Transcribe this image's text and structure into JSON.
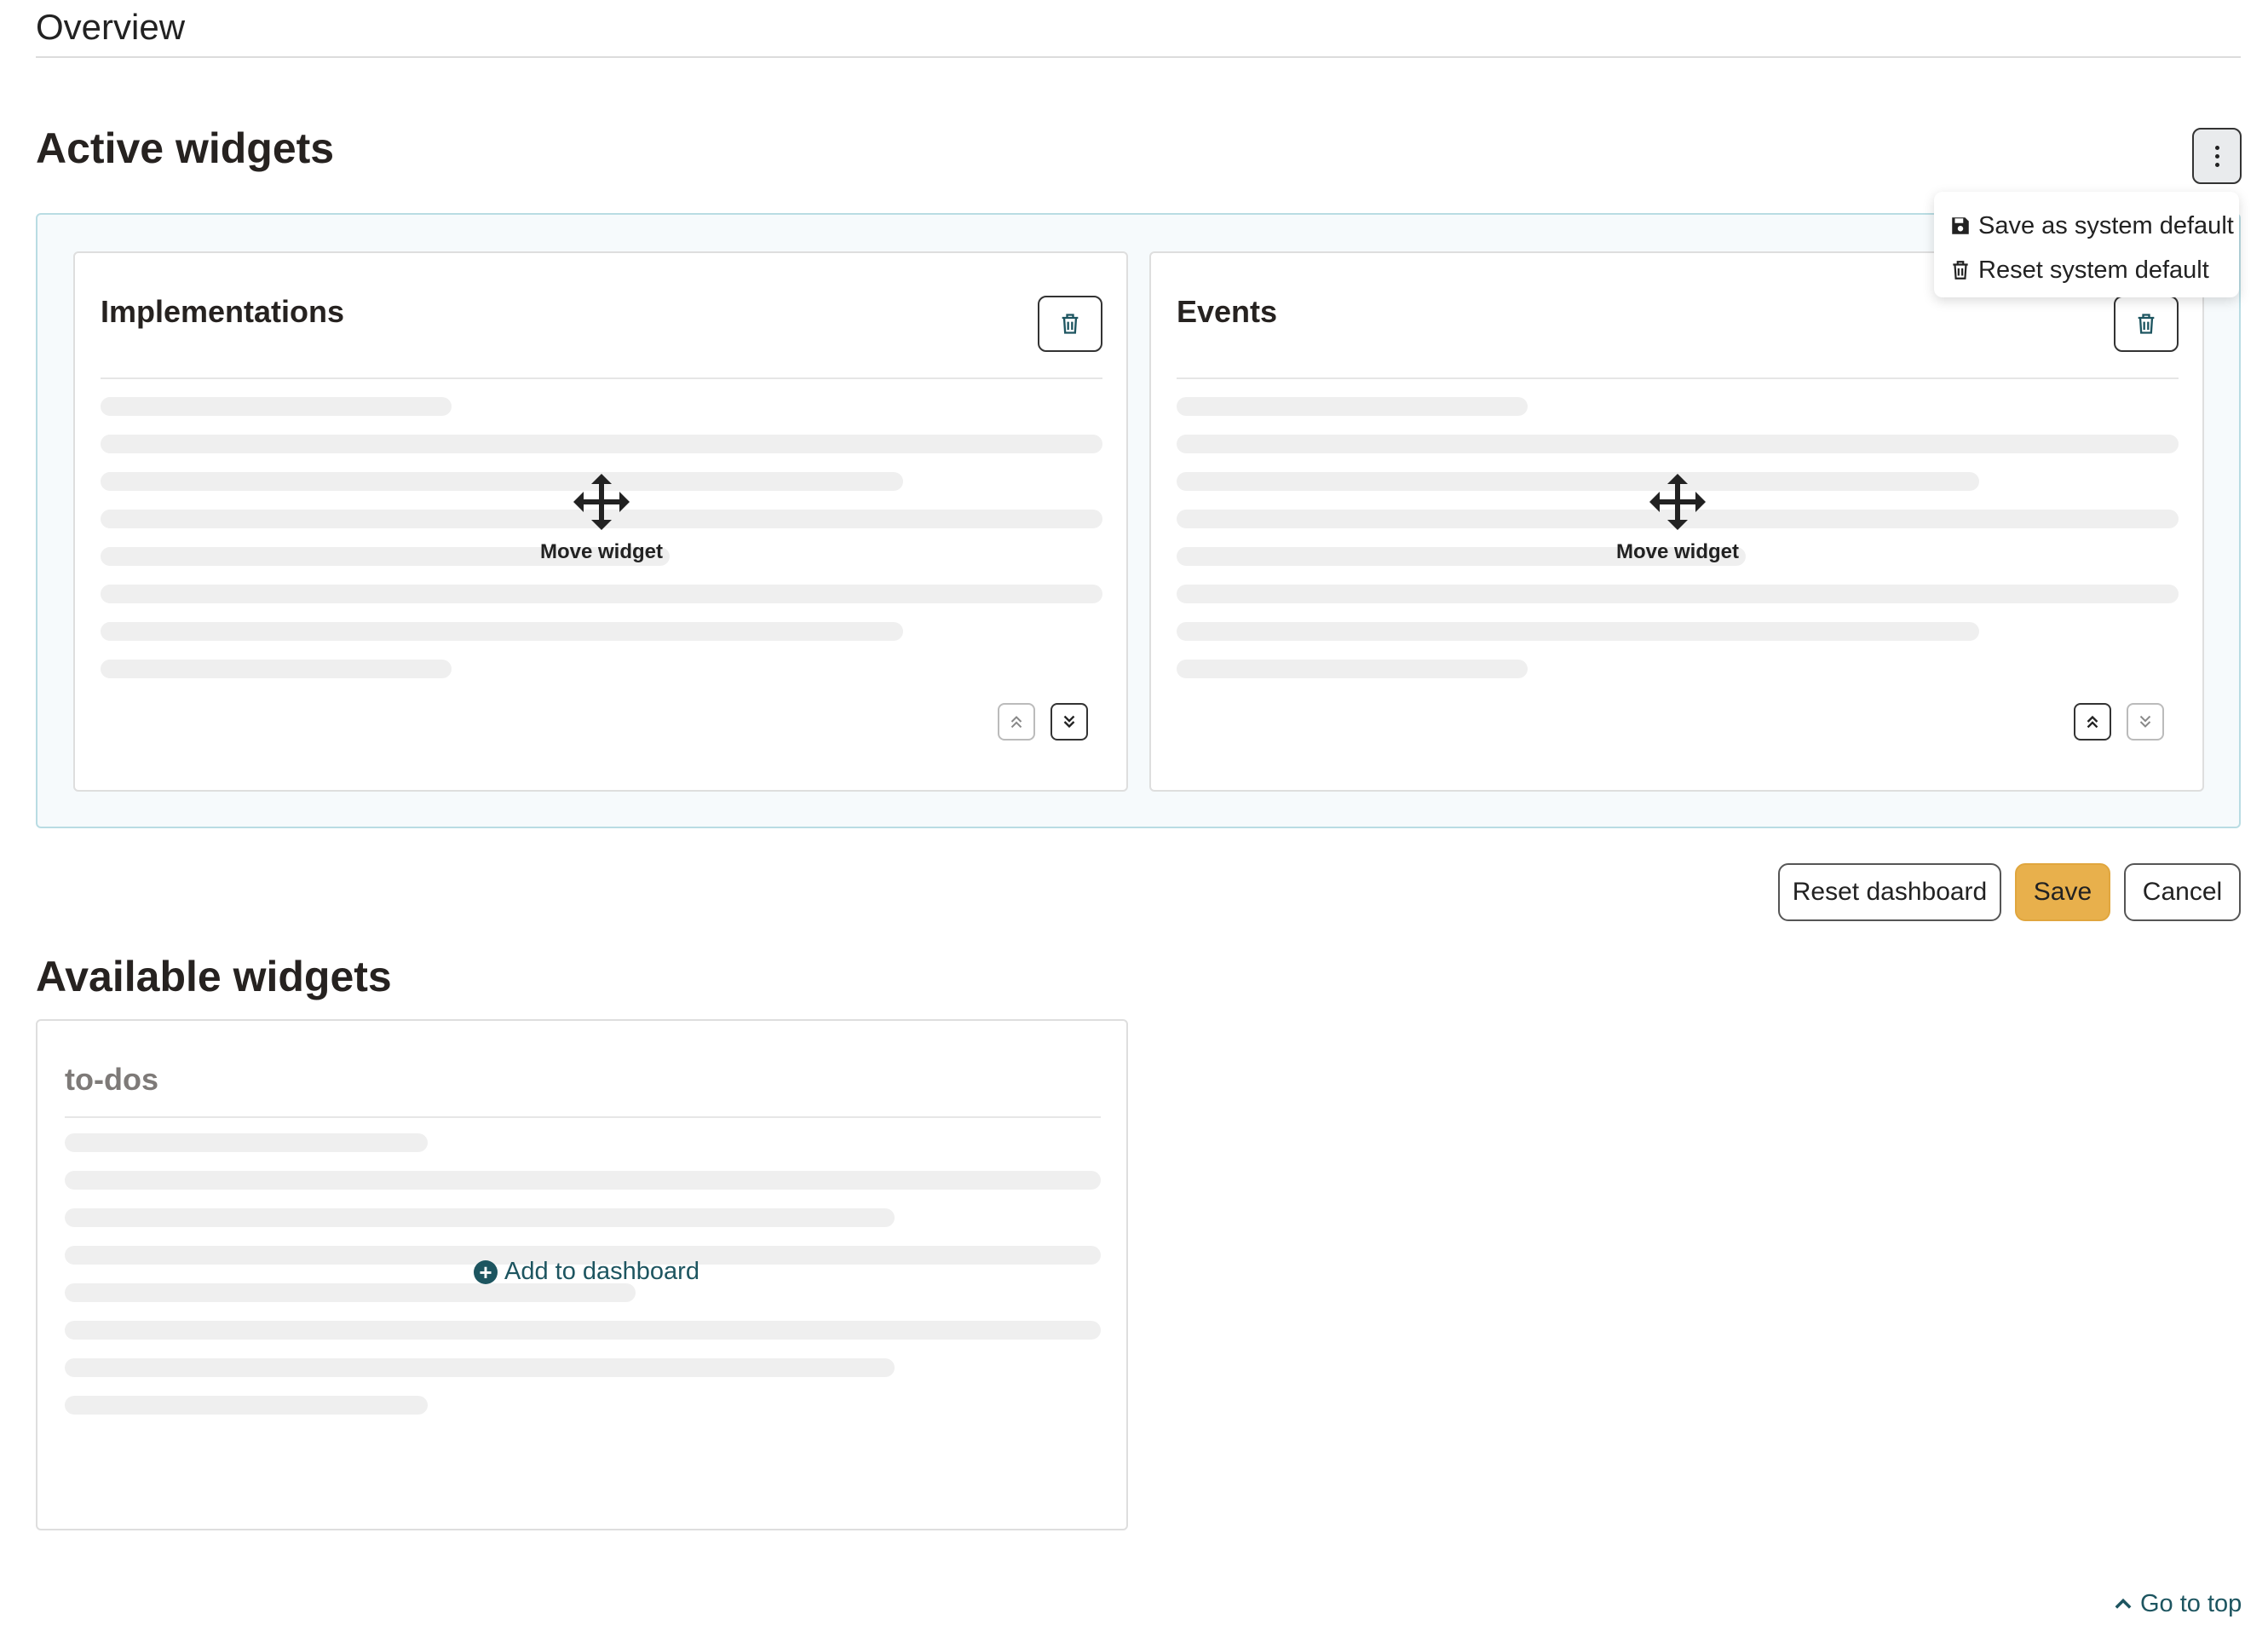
{
  "page": {
    "title": "Overview"
  },
  "active": {
    "heading": "Active widgets",
    "menu": {
      "items": [
        {
          "label": "Save as system default",
          "icon": "floppy-disk-icon"
        },
        {
          "label": "Reset system default",
          "icon": "trash-icon"
        }
      ]
    },
    "widgets": [
      {
        "title": "Implementations",
        "move_label": "Move widget"
      },
      {
        "title": "Events",
        "move_label": "Move widget"
      }
    ]
  },
  "actions": {
    "reset_label": "Reset dashboard",
    "save_label": "Save",
    "cancel_label": "Cancel"
  },
  "available": {
    "heading": "Available widgets",
    "widgets": [
      {
        "title": "to-dos",
        "add_label": "Add to dashboard"
      }
    ]
  },
  "footer": {
    "go_top_label": "Go to top"
  },
  "colors": {
    "accent": "#1d5560",
    "save_button": "#e8b04c",
    "active_border": "#b9dce3"
  }
}
